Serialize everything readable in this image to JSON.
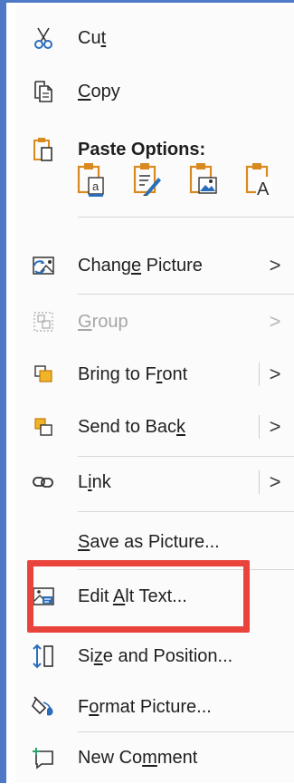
{
  "menu": {
    "items": [
      {
        "id": "cut",
        "pre": "Cu",
        "u": "t",
        "post": ""
      },
      {
        "id": "copy",
        "pre": "",
        "u": "C",
        "post": "opy"
      },
      {
        "id": "paste_options",
        "label": "Paste Options:"
      },
      {
        "id": "change_picture",
        "pre": "Chang",
        "u": "e",
        "post": " Picture"
      },
      {
        "id": "group",
        "pre": "",
        "u": "G",
        "post": "roup"
      },
      {
        "id": "bring_to_front",
        "pre": "Bring to F",
        "u": "r",
        "post": "ont"
      },
      {
        "id": "send_to_back",
        "pre": "Send to Bac",
        "u": "k",
        "post": ""
      },
      {
        "id": "link",
        "pre": "L",
        "u": "i",
        "post": "nk"
      },
      {
        "id": "save_as_picture",
        "pre": "",
        "u": "S",
        "post": "ave as Picture..."
      },
      {
        "id": "edit_alt_text",
        "pre": "Edit ",
        "u": "A",
        "post": "lt Text..."
      },
      {
        "id": "size_and_position",
        "pre": "Si",
        "u": "z",
        "post": "e and Position..."
      },
      {
        "id": "format_picture",
        "pre": "F",
        "u": "o",
        "post": "rmat Picture..."
      },
      {
        "id": "new_comment",
        "pre": "New Co",
        "u": "m",
        "post": "ment"
      }
    ],
    "chevron": ">"
  },
  "paste_icons": [
    "paste-keep-source-formatting-icon",
    "paste-merge-formatting-icon",
    "paste-picture-icon",
    "paste-keep-text-only-icon"
  ],
  "colors": {
    "frame": "#4f79c6",
    "highlight": "#e8443b",
    "accent_orange": "#d98a1f",
    "accent_blue": "#2a6ebb"
  }
}
